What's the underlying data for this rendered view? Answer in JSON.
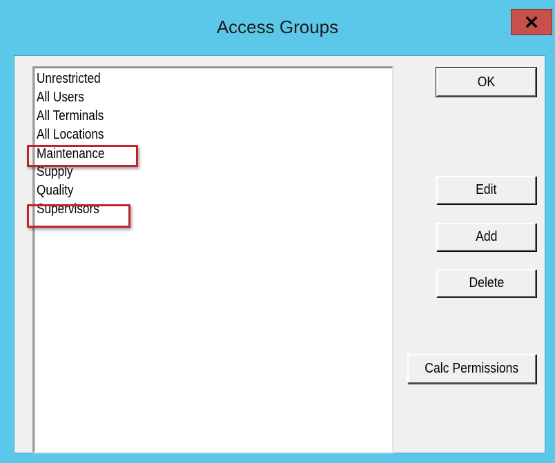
{
  "window": {
    "title": "Access Groups",
    "close_icon": "close-icon"
  },
  "list": {
    "items": [
      {
        "label": "Unrestricted",
        "highlighted": false
      },
      {
        "label": "All Users",
        "highlighted": false
      },
      {
        "label": "All Terminals",
        "highlighted": false
      },
      {
        "label": "All Locations",
        "highlighted": false
      },
      {
        "label": "Maintenance",
        "highlighted": true
      },
      {
        "label": "Supply",
        "highlighted": false
      },
      {
        "label": "Quality",
        "highlighted": false
      },
      {
        "label": "Supervisors",
        "highlighted": true
      }
    ]
  },
  "buttons": {
    "ok": "OK",
    "edit": "Edit",
    "add": "Add",
    "delete": "Delete",
    "calc_permissions": "Calc Permissions"
  },
  "colors": {
    "titlebar": "#5bc8ea",
    "close_button": "#c7504a",
    "highlight_box": "#c0252a",
    "dialog_background": "#f0f0f0"
  }
}
